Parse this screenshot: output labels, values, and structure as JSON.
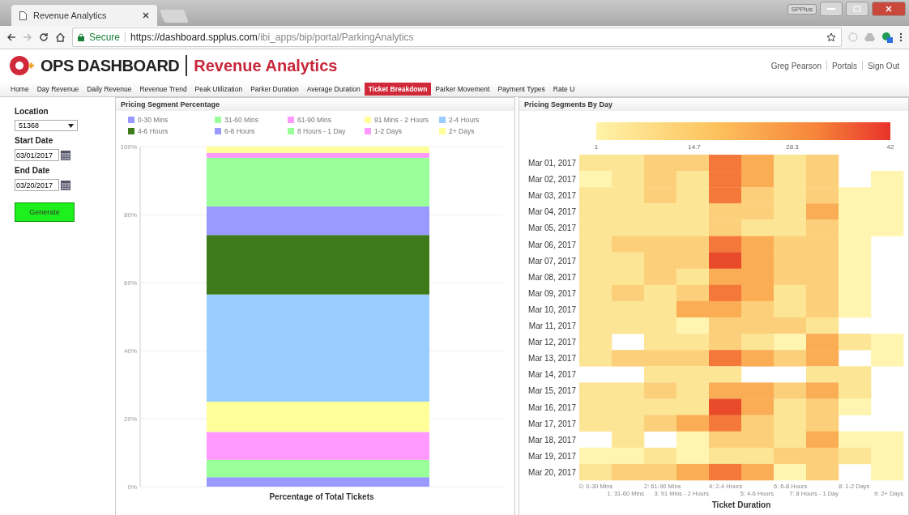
{
  "browser": {
    "tab_title": "Revenue Analytics",
    "profile": "SPPlus",
    "secure_label": "Secure",
    "url_host": "https://dashboard.spplus.com",
    "url_path": "/ibi_apps/bip/portal/ParkingAnalytics"
  },
  "header": {
    "brand": "OPS DASHBOARD",
    "page_title": "Revenue Analytics",
    "user_links": [
      "Greg Pearson",
      "Portals",
      "Sign Out"
    ]
  },
  "nav": [
    {
      "label": "Home",
      "selected": false
    },
    {
      "label": "Day Revenue",
      "selected": false
    },
    {
      "label": "Daily Revenue",
      "selected": false
    },
    {
      "label": "Revenue Trend",
      "selected": false
    },
    {
      "label": "Peak Utilization",
      "selected": false
    },
    {
      "label": "Parker Duration",
      "selected": false
    },
    {
      "label": "Average Duration",
      "selected": false
    },
    {
      "label": "Ticket Breakdown",
      "selected": true
    },
    {
      "label": "Parker Movement",
      "selected": false
    },
    {
      "label": "Payment Types",
      "selected": false
    },
    {
      "label": "Rate U",
      "selected": false
    }
  ],
  "filters": {
    "location_label": "Location",
    "location_value": "51368",
    "start_label": "Start Date",
    "start_value": "03/01/2017",
    "end_label": "End Date",
    "end_value": "03/20/2017",
    "button": "Generate"
  },
  "segment_panel": {
    "title": "Pricing Segment Percentage",
    "chart_data": {
      "type": "bar",
      "stacked": true,
      "grid": true,
      "xlabel": "Percentage of Total Tickets",
      "ylim": [
        0,
        100
      ],
      "yticks": [
        {
          "value": 0,
          "label": "0%"
        },
        {
          "value": 20,
          "label": "20%"
        },
        {
          "value": 40,
          "label": "40%"
        },
        {
          "value": 60,
          "label": "60%"
        },
        {
          "value": 80,
          "label": "80%"
        },
        {
          "value": 100,
          "label": "100%"
        }
      ],
      "series": [
        {
          "name": "0-30 Mins",
          "color": "#9999ff",
          "values": [
            2.8
          ]
        },
        {
          "name": "31-60 Mins",
          "color": "#99ff99",
          "values": [
            5.1
          ]
        },
        {
          "name": "61-90 Mins",
          "color": "#ff99ff",
          "values": [
            8.2
          ]
        },
        {
          "name": "91 Mins - 2 Hours",
          "color": "#ffff99",
          "values": [
            8.9
          ]
        },
        {
          "name": "2-4 Hours",
          "color": "#99ccff",
          "values": [
            31.5
          ]
        },
        {
          "name": "4-6 Hours",
          "color": "#3f7a1a",
          "values": [
            17.5
          ]
        },
        {
          "name": "6-8 Hours",
          "color": "#9999ff",
          "values": [
            8.4
          ]
        },
        {
          "name": "8 Hours - 1 Day",
          "color": "#99ff99",
          "values": [
            14.3
          ]
        },
        {
          "name": "1-2 Days",
          "color": "#ff99ff",
          "values": [
            1.4
          ]
        },
        {
          "name": "2+ Days",
          "color": "#ffff99",
          "values": [
            1.9
          ]
        }
      ]
    }
  },
  "day_panel": {
    "title": "Pricing Segments By Day",
    "scale_ticks": [
      "1",
      "14.7",
      "28.3",
      "42"
    ],
    "xlabel": "Ticket Duration",
    "columns": [
      "0: 0-30 Mins",
      "1: 31-60 Mins",
      "2: 61-90 Mins",
      "3: 91 Mins - 2 Hours",
      "4: 2-4 Hours",
      "5: 4-6 Hours",
      "6: 6-8 Hours",
      "7: 8 Hours - 1 Day",
      "8: 1-2 Days",
      "9: 2+ Days"
    ],
    "rows": [
      {
        "label": "Mar 01, 2017",
        "cells": [
          {
            "color": "#fde596"
          },
          {
            "color": "#fde596"
          },
          {
            "color": "#fcd07a"
          },
          {
            "color": "#fcd07a"
          },
          {
            "color": "#f4783a"
          },
          {
            "color": "#fbad55"
          },
          {
            "color": "#fde596"
          },
          {
            "color": "#fcd07a"
          },
          null,
          null
        ]
      },
      {
        "label": "Mar 02, 2017",
        "cells": [
          {
            "color": "#fff5b0"
          },
          {
            "color": "#fde596"
          },
          {
            "color": "#fcd07a"
          },
          {
            "color": "#fde596"
          },
          {
            "color": "#f4783a"
          },
          {
            "color": "#fbad55"
          },
          {
            "color": "#fde596"
          },
          {
            "color": "#fcd07a"
          },
          null,
          {
            "color": "#fff5b0"
          }
        ]
      },
      {
        "label": "Mar 03, 2017",
        "cells": [
          {
            "color": "#fde596"
          },
          {
            "color": "#fde596"
          },
          {
            "color": "#fcd07a"
          },
          {
            "color": "#fde596"
          },
          {
            "color": "#f4783a"
          },
          {
            "color": "#fcd07a"
          },
          {
            "color": "#fde596"
          },
          {
            "color": "#fcd07a"
          },
          {
            "color": "#fff5b0"
          },
          {
            "color": "#fff5b0"
          }
        ]
      },
      {
        "label": "Mar 04, 2017",
        "cells": [
          {
            "color": "#fde596"
          },
          {
            "color": "#fde596"
          },
          {
            "color": "#fde596"
          },
          {
            "color": "#fde596"
          },
          {
            "color": "#fcd07a"
          },
          {
            "color": "#fcd07a"
          },
          {
            "color": "#fde596"
          },
          {
            "color": "#fbad55"
          },
          {
            "color": "#fff5b0"
          },
          {
            "color": "#fff5b0"
          }
        ]
      },
      {
        "label": "Mar 05, 2017",
        "cells": [
          {
            "color": "#fde596"
          },
          {
            "color": "#fde596"
          },
          {
            "color": "#fde596"
          },
          {
            "color": "#fde596"
          },
          {
            "color": "#fcd07a"
          },
          {
            "color": "#fde596"
          },
          {
            "color": "#fde596"
          },
          {
            "color": "#fcd07a"
          },
          {
            "color": "#fff5b0"
          },
          {
            "color": "#fff5b0"
          }
        ]
      },
      {
        "label": "Mar 06, 2017",
        "cells": [
          {
            "color": "#fde596"
          },
          {
            "color": "#fcd07a"
          },
          {
            "color": "#fcd07a"
          },
          {
            "color": "#fcd07a"
          },
          {
            "color": "#f4783a"
          },
          {
            "color": "#fbad55"
          },
          {
            "color": "#fcd07a"
          },
          {
            "color": "#fcd07a"
          },
          {
            "color": "#fff5b0"
          },
          null
        ]
      },
      {
        "label": "Mar 07, 2017",
        "cells": [
          {
            "color": "#fde596"
          },
          {
            "color": "#fde596"
          },
          {
            "color": "#fcd07a"
          },
          {
            "color": "#fcd07a"
          },
          {
            "color": "#e84a2a"
          },
          {
            "color": "#fbad55"
          },
          {
            "color": "#fcd07a"
          },
          {
            "color": "#fcd07a"
          },
          {
            "color": "#fff5b0"
          },
          null
        ]
      },
      {
        "label": "Mar 08, 2017",
        "cells": [
          {
            "color": "#fde596"
          },
          {
            "color": "#fde596"
          },
          {
            "color": "#fcd07a"
          },
          {
            "color": "#fde596"
          },
          {
            "color": "#fbad55"
          },
          {
            "color": "#fbad55"
          },
          {
            "color": "#fcd07a"
          },
          {
            "color": "#fcd07a"
          },
          {
            "color": "#fff5b0"
          },
          null
        ]
      },
      {
        "label": "Mar 09, 2017",
        "cells": [
          {
            "color": "#fde596"
          },
          {
            "color": "#fcd07a"
          },
          {
            "color": "#fde596"
          },
          {
            "color": "#fcd07a"
          },
          {
            "color": "#f4783a"
          },
          {
            "color": "#fbad55"
          },
          {
            "color": "#fde596"
          },
          {
            "color": "#fcd07a"
          },
          {
            "color": "#fff5b0"
          },
          null
        ]
      },
      {
        "label": "Mar 10, 2017",
        "cells": [
          {
            "color": "#fde596"
          },
          {
            "color": "#fde596"
          },
          {
            "color": "#fde596"
          },
          {
            "color": "#fbad55"
          },
          {
            "color": "#fbad55"
          },
          {
            "color": "#fcd07a"
          },
          {
            "color": "#fde596"
          },
          {
            "color": "#fcd07a"
          },
          {
            "color": "#fff5b0"
          },
          null
        ]
      },
      {
        "label": "Mar 11, 2017",
        "cells": [
          {
            "color": "#fde596"
          },
          {
            "color": "#fde596"
          },
          {
            "color": "#fde596"
          },
          {
            "color": "#fff5b0"
          },
          {
            "color": "#fcd07a"
          },
          {
            "color": "#fcd07a"
          },
          {
            "color": "#fcd07a"
          },
          {
            "color": "#fde596"
          },
          null,
          null
        ]
      },
      {
        "label": "Mar 12, 2017",
        "cells": [
          {
            "color": "#fde596"
          },
          null,
          {
            "color": "#fde596"
          },
          {
            "color": "#fde596"
          },
          {
            "color": "#fcd07a"
          },
          {
            "color": "#fde596"
          },
          {
            "color": "#fff5b0"
          },
          {
            "color": "#fbad55"
          },
          {
            "color": "#fde596"
          },
          {
            "color": "#fff5b0"
          }
        ]
      },
      {
        "label": "Mar 13, 2017",
        "cells": [
          {
            "color": "#fde596"
          },
          {
            "color": "#fcd07a"
          },
          {
            "color": "#fcd07a"
          },
          {
            "color": "#fcd07a"
          },
          {
            "color": "#f4783a"
          },
          {
            "color": "#fbad55"
          },
          {
            "color": "#fcd07a"
          },
          {
            "color": "#fbad55"
          },
          null,
          {
            "color": "#fff5b0"
          }
        ]
      },
      {
        "label": "Mar 14, 2017",
        "cells": [
          null,
          null,
          {
            "color": "#fde596"
          },
          {
            "color": "#fde596"
          },
          {
            "color": "#fde596"
          },
          null,
          null,
          {
            "color": "#fde596"
          },
          {
            "color": "#fde596"
          },
          null
        ]
      },
      {
        "label": "Mar 15, 2017",
        "cells": [
          {
            "color": "#fde596"
          },
          {
            "color": "#fde596"
          },
          {
            "color": "#fcd07a"
          },
          {
            "color": "#fde596"
          },
          {
            "color": "#fbad55"
          },
          {
            "color": "#fbad55"
          },
          {
            "color": "#fcd07a"
          },
          {
            "color": "#fbad55"
          },
          {
            "color": "#fde596"
          },
          null
        ]
      },
      {
        "label": "Mar 16, 2017",
        "cells": [
          {
            "color": "#fde596"
          },
          {
            "color": "#fde596"
          },
          {
            "color": "#fde596"
          },
          {
            "color": "#fde596"
          },
          {
            "color": "#e84a2a"
          },
          {
            "color": "#fbad55"
          },
          {
            "color": "#fde596"
          },
          {
            "color": "#fcd07a"
          },
          {
            "color": "#fff5b0"
          },
          null
        ]
      },
      {
        "label": "Mar 17, 2017",
        "cells": [
          {
            "color": "#fde596"
          },
          {
            "color": "#fde596"
          },
          {
            "color": "#fcd07a"
          },
          {
            "color": "#fbad55"
          },
          {
            "color": "#f4783a"
          },
          {
            "color": "#fcd07a"
          },
          {
            "color": "#fde596"
          },
          {
            "color": "#fcd07a"
          },
          null,
          null
        ]
      },
      {
        "label": "Mar 18, 2017",
        "cells": [
          null,
          {
            "color": "#fde596"
          },
          null,
          {
            "color": "#fff5b0"
          },
          {
            "color": "#fcd07a"
          },
          {
            "color": "#fcd07a"
          },
          {
            "color": "#fde596"
          },
          {
            "color": "#fbad55"
          },
          {
            "color": "#fff5b0"
          },
          {
            "color": "#fff5b0"
          }
        ]
      },
      {
        "label": "Mar 19, 2017",
        "cells": [
          {
            "color": "#fff5b0"
          },
          {
            "color": "#fff5b0"
          },
          {
            "color": "#fde596"
          },
          {
            "color": "#fff5b0"
          },
          {
            "color": "#fde596"
          },
          {
            "color": "#fde596"
          },
          {
            "color": "#fcd07a"
          },
          {
            "color": "#fcd07a"
          },
          {
            "color": "#fde596"
          },
          {
            "color": "#fff5b0"
          }
        ]
      },
      {
        "label": "Mar 20, 2017",
        "cells": [
          {
            "color": "#fde596"
          },
          {
            "color": "#fcd07a"
          },
          {
            "color": "#fcd07a"
          },
          {
            "color": "#fbad55"
          },
          {
            "color": "#f4783a"
          },
          {
            "color": "#fbad55"
          },
          {
            "color": "#fff5b0"
          },
          {
            "color": "#fcd07a"
          },
          null,
          {
            "color": "#fff5b0"
          }
        ]
      }
    ]
  }
}
